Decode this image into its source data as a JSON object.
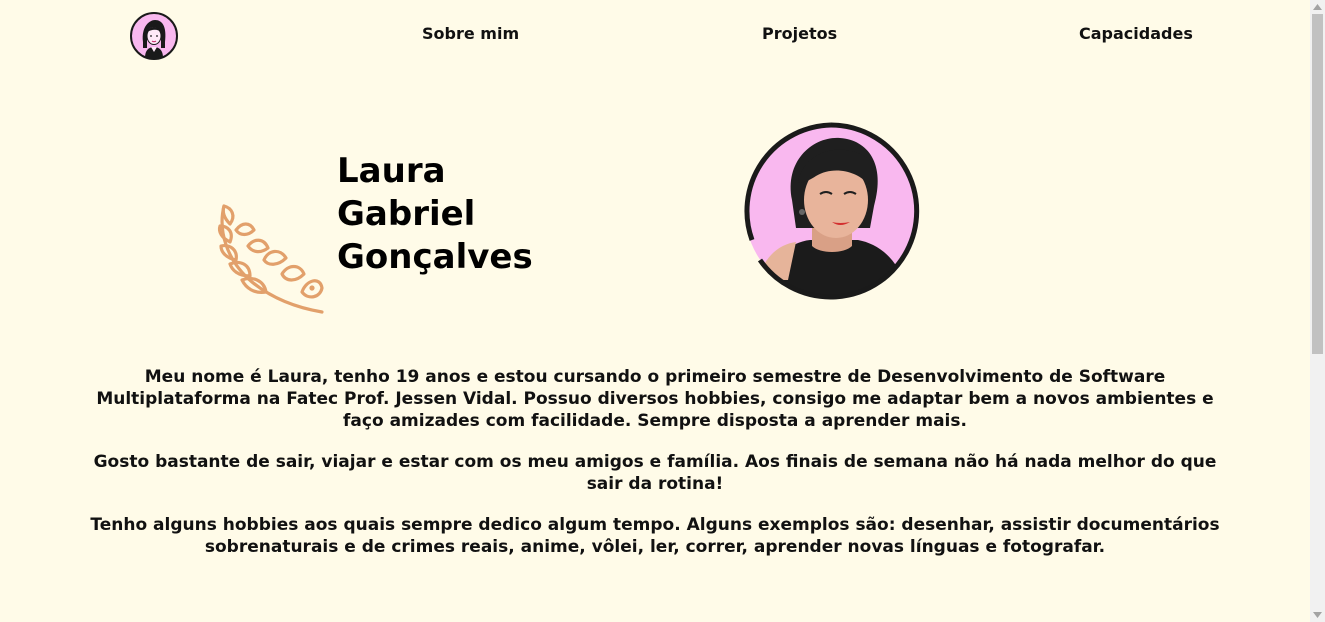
{
  "header": {
    "nav": [
      {
        "label": "Sobre mim"
      },
      {
        "label": "Projetos"
      },
      {
        "label": "Capacidades"
      }
    ]
  },
  "hero": {
    "name_lines": [
      "Laura",
      "Gabriel",
      "Gonçalves"
    ]
  },
  "about": {
    "paragraphs": [
      "Meu nome é Laura, tenho 19 anos e estou cursando o primeiro semestre de Desenvolvimento de Software Multiplataforma na Fatec Prof. Jessen Vidal. Possuo diversos hobbies, consigo me adaptar bem a novos ambientes e faço amizades com facilidade. Sempre disposta a aprender mais.",
      "Gosto bastante de sair, viajar e estar com os meu amigos e família. Aos finais de semana não há nada melhor do que sair da rotina!",
      "Tenho alguns hobbies aos quais sempre dedico algum tempo. Alguns exemplos são: desenhar, assistir documentários sobrenaturais e de crimes reais, anime, vôlei, ler, correr, aprender novas línguas e fotografar."
    ]
  },
  "colors": {
    "background": "#fffbe8",
    "accent_pink": "#f9b8ef",
    "laurel": "#e2a06b",
    "text": "#111111"
  },
  "icons": {
    "logo": "girl-avatar-icon",
    "laurel": "laurel-branch-icon",
    "profile_photo": "profile-photo"
  }
}
